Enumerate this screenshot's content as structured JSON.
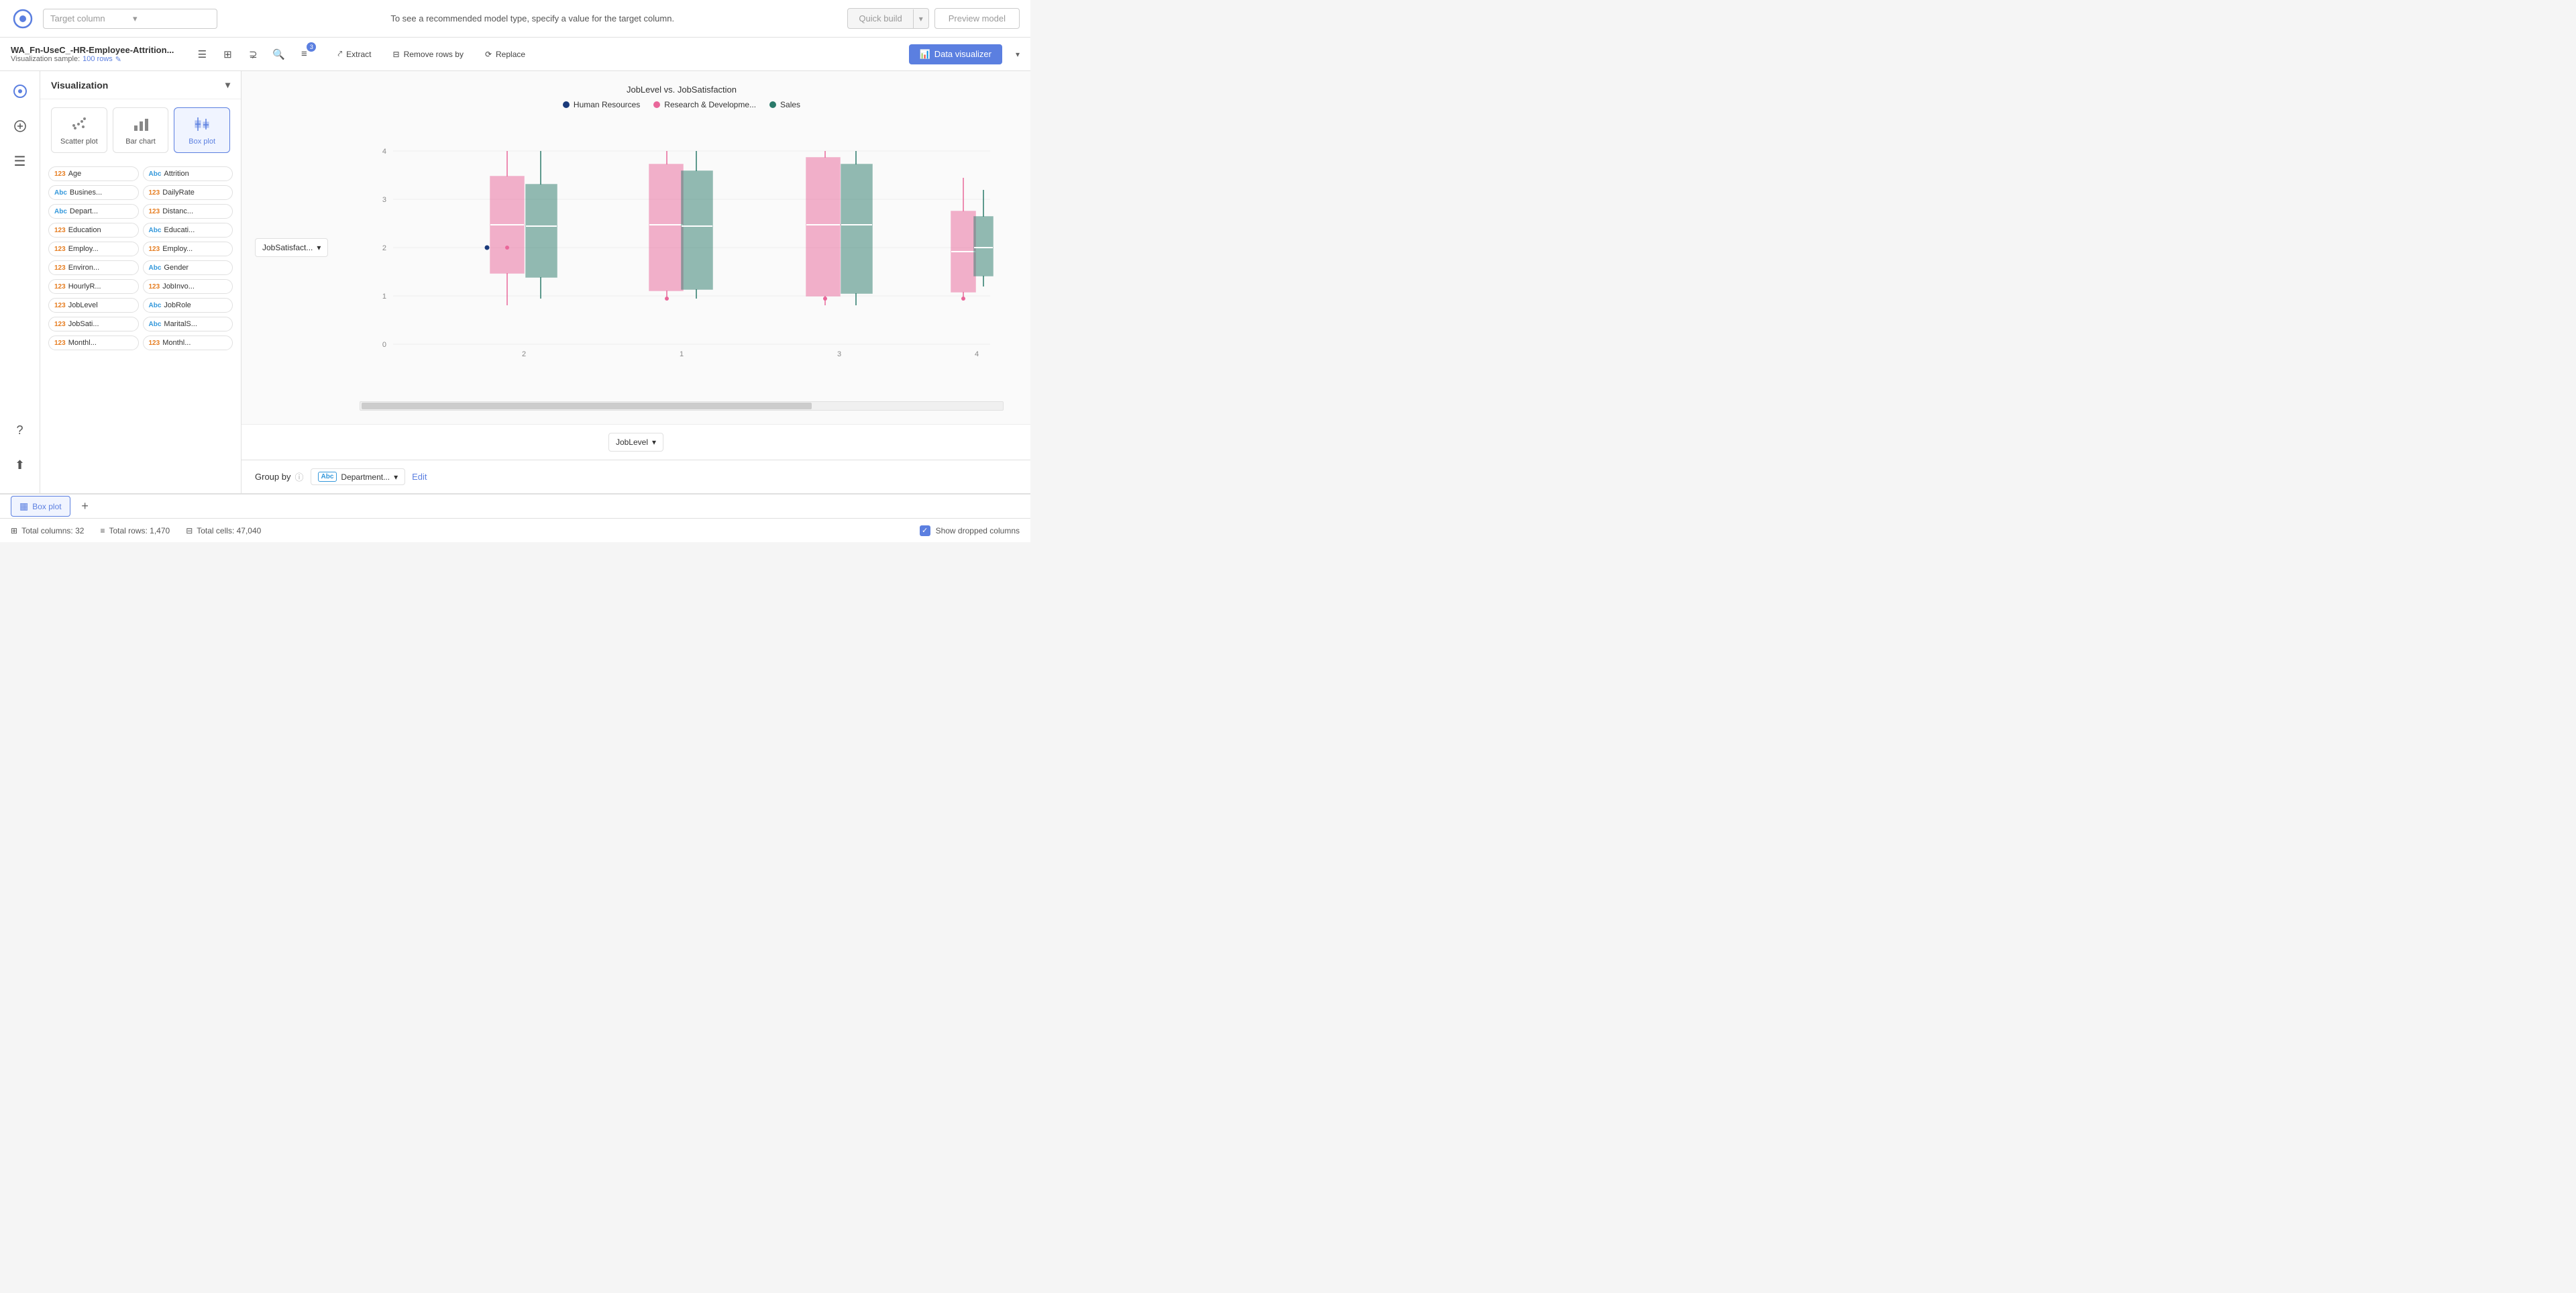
{
  "topBar": {
    "targetColumnPlaceholder": "Target column",
    "centerText": "To see a recommended model type, specify a value for the target column.",
    "quickBuildLabel": "Quick build",
    "previewModelLabel": "Preview model"
  },
  "secondBar": {
    "fileName": "WA_Fn-UseC_-HR-Employee-Attrition...",
    "vizSampleLabel": "Visualization sample:",
    "sampleRows": "100 rows",
    "extractLabel": "Extract",
    "removeRowsLabel": "Remove rows by",
    "replaceLabel": "Replace",
    "dataVizLabel": "Data visualizer",
    "badgeCount": "3"
  },
  "vizPanel": {
    "title": "Visualization",
    "types": [
      {
        "id": "scatter",
        "label": "Scatter plot",
        "active": false
      },
      {
        "id": "bar",
        "label": "Bar chart",
        "active": false
      },
      {
        "id": "box",
        "label": "Box plot",
        "active": true
      }
    ]
  },
  "columns": [
    {
      "type": "123",
      "typeClass": "num",
      "name": "Age"
    },
    {
      "type": "Abc",
      "typeClass": "abc",
      "name": "Attrition"
    },
    {
      "type": "Abc",
      "typeClass": "abc",
      "name": "Busines..."
    },
    {
      "type": "123",
      "typeClass": "num",
      "name": "DailyRate"
    },
    {
      "type": "Abc",
      "typeClass": "abc",
      "name": "Depart..."
    },
    {
      "type": "123",
      "typeClass": "num",
      "name": "Distanc..."
    },
    {
      "type": "123",
      "typeClass": "num",
      "name": "Education"
    },
    {
      "type": "Abc",
      "typeClass": "abc",
      "name": "Educati..."
    },
    {
      "type": "123",
      "typeClass": "num",
      "name": "Employ..."
    },
    {
      "type": "123",
      "typeClass": "num",
      "name": "Employ..."
    },
    {
      "type": "123",
      "typeClass": "num",
      "name": "Environ..."
    },
    {
      "type": "Abc",
      "typeClass": "abc",
      "name": "Gender"
    },
    {
      "type": "123",
      "typeClass": "num",
      "name": "HourlyR..."
    },
    {
      "type": "123",
      "typeClass": "num",
      "name": "JobInvo..."
    },
    {
      "type": "123",
      "typeClass": "num",
      "name": "JobLevel"
    },
    {
      "type": "Abc",
      "typeClass": "abc",
      "name": "JobRole"
    },
    {
      "type": "123",
      "typeClass": "num",
      "name": "JobSati..."
    },
    {
      "type": "Abc",
      "typeClass": "abc",
      "name": "MaritalS..."
    },
    {
      "type": "123",
      "typeClass": "num",
      "name": "Monthl..."
    },
    {
      "type": "123",
      "typeClass": "num",
      "name": "Monthl..."
    }
  ],
  "chart": {
    "title": "JobLevel vs. JobSatisfaction",
    "yAxisLabel": "JobSatisfact...",
    "xAxisLabel": "JobLevel",
    "legend": [
      {
        "label": "Human Resources",
        "color": "#1a3a7a"
      },
      {
        "label": "Research & Developme...",
        "color": "#e9679a"
      },
      {
        "label": "Sales",
        "color": "#2a7a6a"
      }
    ],
    "xTicks": [
      "2",
      "1",
      "3",
      "4"
    ],
    "yTicks": [
      "0",
      "1",
      "2",
      "3",
      "4"
    ],
    "educationLabel": "123 Education"
  },
  "groupBy": {
    "label": "Group by",
    "value": "Department...",
    "editLabel": "Edit"
  },
  "tabs": [
    {
      "label": "Box plot",
      "active": true,
      "icon": "▦"
    }
  ],
  "statusBar": {
    "totalColumns": "Total columns: 32",
    "totalRows": "Total rows: 1,470",
    "totalCells": "Total cells: 47,040",
    "showDroppedColumns": "Show dropped columns"
  }
}
